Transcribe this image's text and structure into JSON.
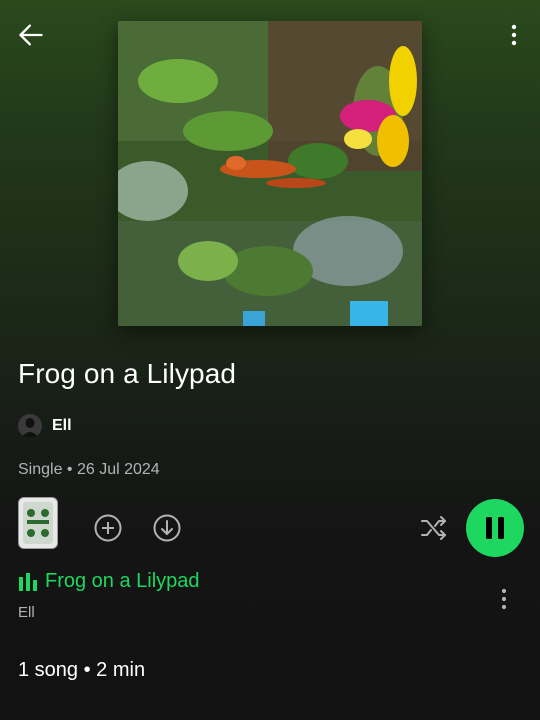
{
  "header": {
    "back_icon": "arrow-left-icon",
    "more_icon": "more-vertical-icon"
  },
  "album": {
    "title": "Frog on a Lilypad",
    "artist": "Ell",
    "type_and_date": "Single • 26 Jul 2024"
  },
  "actions": {
    "add_icon": "plus-circle-icon",
    "download_icon": "download-circle-icon",
    "shuffle_icon": "shuffle-icon",
    "play_pause_icon": "pause-icon"
  },
  "tracks": [
    {
      "title": "Frog on a Lilypad",
      "artist": "Ell",
      "playing": true
    }
  ],
  "summary": "1 song • 2 min",
  "colors": {
    "accent": "#1ed760",
    "background": "#121212",
    "secondary_text": "#b3b3b3"
  }
}
